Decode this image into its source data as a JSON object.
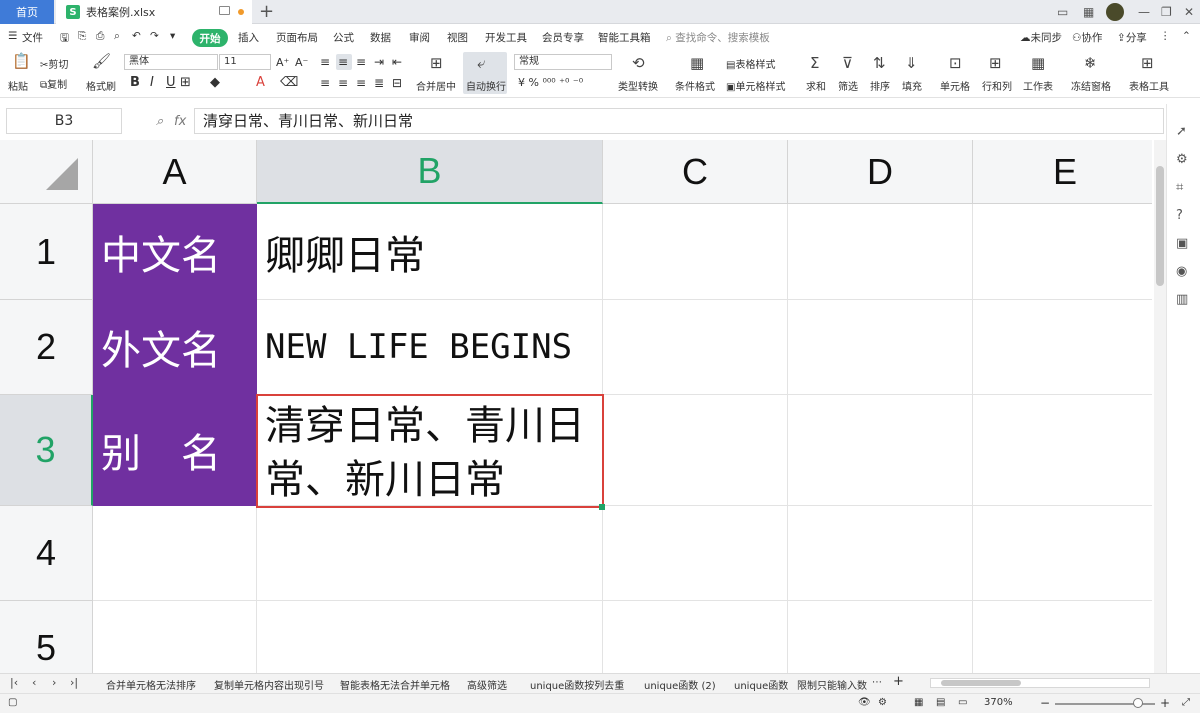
{
  "titlebar": {
    "home_tab": "首页",
    "doc_tab": "表格案例.xlsx",
    "doc_icon": "S",
    "new_tab": "+"
  },
  "menu": {
    "file": "文件",
    "items": [
      "开始",
      "插入",
      "页面布局",
      "公式",
      "数据",
      "审阅",
      "视图",
      "开发工具",
      "会员专享",
      "智能工具箱"
    ],
    "search": "查找命令、搜索模板",
    "sync": "未同步",
    "collab": "协作",
    "share": "分享"
  },
  "ribbon": {
    "paste": "粘贴",
    "cut": "剪切",
    "copy": "复制",
    "format_painter": "格式刷",
    "font_name": "黑体",
    "font_size": "11",
    "merge_center": "合并居中",
    "wrap_text": "自动换行",
    "number_format": "常规",
    "type_convert": "类型转换",
    "cond_format": "条件格式",
    "table_style": "表格样式",
    "cell_style": "单元格样式",
    "sum": "求和",
    "filter": "筛选",
    "sort": "排序",
    "fill": "填充",
    "cell": "单元格",
    "row_col": "行和列",
    "worksheet": "工作表",
    "freeze": "冻结窗格",
    "table_tools": "表格工具"
  },
  "formula_bar": {
    "name_box": "B3",
    "fx": "fx",
    "value": "清穿日常、青川日常、新川日常"
  },
  "grid": {
    "columns": [
      "A",
      "B",
      "C",
      "D",
      "E"
    ],
    "rows": [
      "1",
      "2",
      "3",
      "4",
      "5"
    ],
    "cells": {
      "A1": "中文名",
      "B1": "卿卿日常",
      "A2": "外文名",
      "B2": "NEW LIFE BEGINS",
      "A3": "别　名",
      "B3": "清穿日常、青川日常、新川日常"
    },
    "header_fill": "#7030a0",
    "selection_color": "#d9413b",
    "active_header_color": "#21a366"
  },
  "sheets": [
    "合并单元格无法排序",
    "复制单元格内容出现引号",
    "智能表格无法合并单元格",
    "高级筛选",
    "unique函数按列去重",
    "unique函数 (2)",
    "unique函数",
    "限制只能输入数"
  ],
  "status": {
    "zoom": "370%"
  }
}
